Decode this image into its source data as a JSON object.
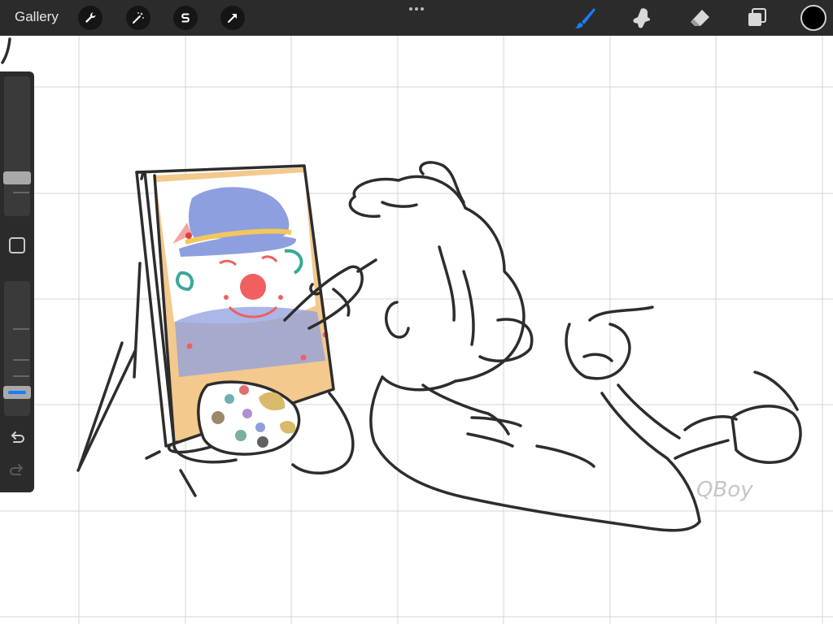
{
  "toolbar": {
    "gallery_label": "Gallery",
    "left_tools": [
      "wrench-icon",
      "magic-wand-icon",
      "selection-s-icon",
      "transform-arrow-icon"
    ],
    "right_tools": [
      "brush-icon",
      "smudge-icon",
      "eraser-icon",
      "layers-icon"
    ],
    "active_tool": "brush-icon",
    "current_color": "#000000"
  },
  "sidebar": {
    "brush_size": 0.25,
    "brush_opacity": 0.14
  },
  "canvas": {
    "signature": "QBoy",
    "grid": true
  },
  "colors": {
    "toolbar_bg": "#2b2b2b",
    "accent": "#1a7cff",
    "clown_hat": "#8e9fe0",
    "paper": "#f3c98d",
    "nose": "#f06060",
    "hair": "#3aa89a"
  }
}
